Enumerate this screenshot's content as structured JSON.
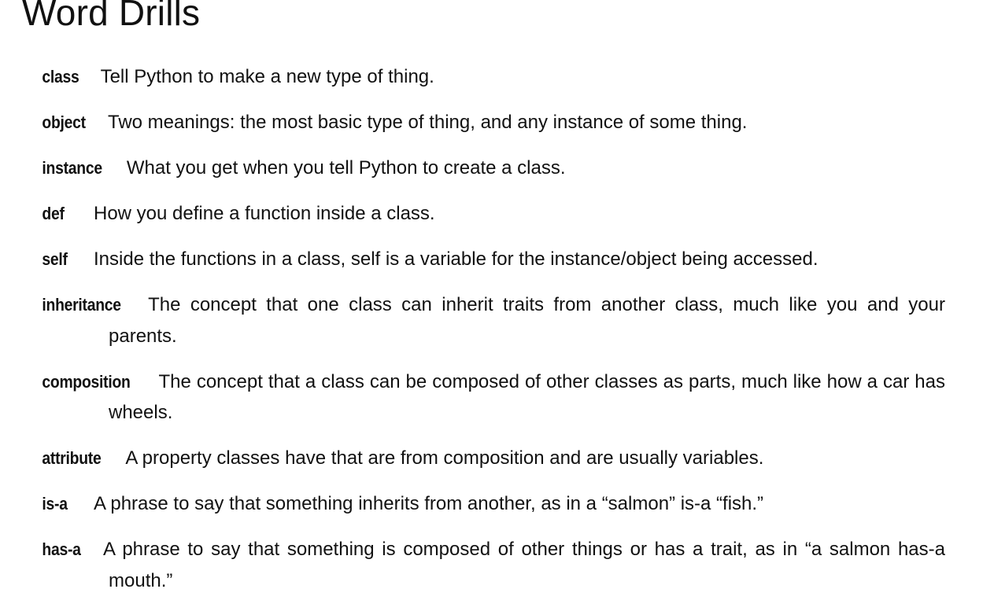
{
  "title": "Word Drills",
  "drills": [
    {
      "term": "class",
      "definition": "Tell Python to make a new type of thing."
    },
    {
      "term": "object",
      "definition": "Two meanings: the most basic type of thing, and any instance of some thing."
    },
    {
      "term": "instance",
      "definition": "What you get when you tell Python to create a class."
    },
    {
      "term": "def",
      "definition": "How you define a function inside a class."
    },
    {
      "term": "self",
      "definition": "Inside the functions in a class, self is a variable for the instance/object being accessed."
    },
    {
      "term": "inheritance",
      "definition": "The concept that one class can inherit traits from another class, much like you and your parents."
    },
    {
      "term": "composition",
      "definition": "The concept that a class can be composed of other classes as parts, much like how a car has wheels."
    },
    {
      "term": "attribute",
      "definition": "A property classes have that are from composition and are usually variables."
    },
    {
      "term": "is-a",
      "definition": "A phrase to say that something inherits from another, as in a “salmon” is-a “fish.”"
    },
    {
      "term": "has-a",
      "definition": "A phrase to say that something is composed of other things or has a trait, as in “a salmon has-a mouth.”"
    }
  ]
}
